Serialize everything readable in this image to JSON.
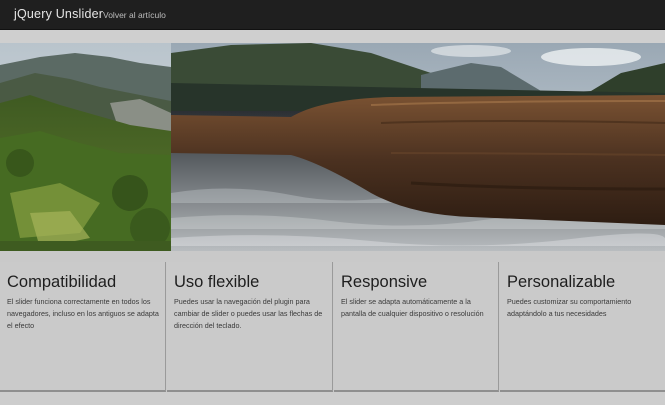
{
  "header": {
    "brand": "jQuery Unslider",
    "back_link": "Volver al artículo"
  },
  "slider": {
    "dots": [
      {
        "active": false
      },
      {
        "active": false
      },
      {
        "active": false
      },
      {
        "active": true
      }
    ]
  },
  "features": [
    {
      "title": "Compatibilidad",
      "text": "El slider funciona correctamente en todos los navegadores, incluso en los antiguos se adapta el efecto"
    },
    {
      "title": "Uso flexible",
      "text": "Puedes usar la navegación del plugin para cambiar de slider o puedes usar las flechas de dirección del teclado."
    },
    {
      "title": "Responsive",
      "text": "El slider se adapta automáticamente a la pantalla de cualquier dispositivo o resolución"
    },
    {
      "title": "Personalizable",
      "text": "Puedes customizar su comportamiento adaptándolo a tus necesidades"
    }
  ]
}
